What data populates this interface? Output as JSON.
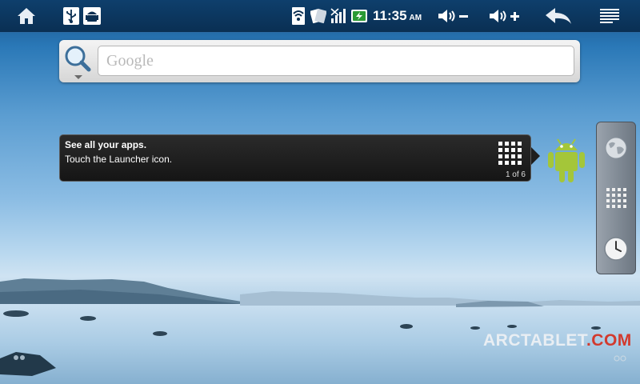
{
  "status_bar": {
    "home_icon": "home-icon",
    "notifications": [
      "usb-icon",
      "android-debug-icon"
    ],
    "system_icons": [
      "wifi-icon",
      "sync-icon",
      "no-signal-icon",
      "battery-charging-icon"
    ],
    "time": "11:35",
    "ampm": "AM",
    "volume_down_icon": "volume-down-icon",
    "volume_up_icon": "volume-up-icon",
    "back_icon": "back-icon",
    "menu_icon": "menu-icon"
  },
  "search": {
    "placeholder": "Google"
  },
  "tooltip": {
    "title": "See all your apps.",
    "body": "Touch the Launcher icon.",
    "counter": "1 of 6"
  },
  "dock": {
    "items": [
      "browser-globe-icon",
      "launcher-grid-icon",
      "clock-icon"
    ]
  },
  "watermark": {
    "main": "ARCTABLET",
    "suffix": ".COM"
  },
  "colors": {
    "status_bar": "#0a2f53",
    "sky_top": "#154f86",
    "sky_horizon": "#cfe3f2",
    "tooltip_bg": "#1e1e1e",
    "android_green": "#a4c639",
    "watermark_accent": "#d23a2e"
  }
}
